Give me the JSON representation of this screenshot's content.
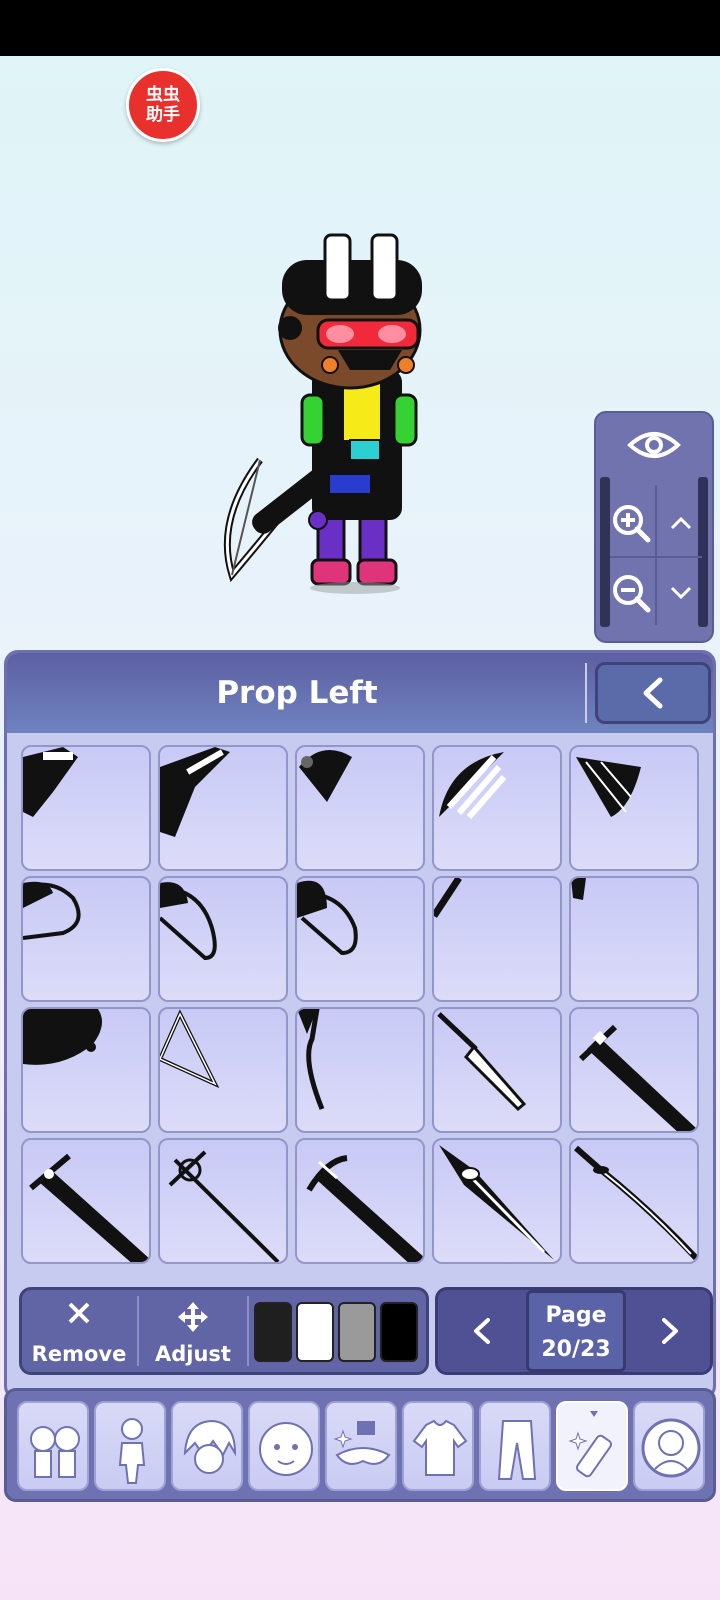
{
  "helper_badge": {
    "line1": "虫虫",
    "line2": "助手"
  },
  "panel": {
    "title": "Prop Left"
  },
  "tools": {
    "remove_label": "Remove",
    "adjust_label": "Adjust"
  },
  "swatches": [
    "#1f1f1f",
    "#ffffff",
    "#9a9a9a",
    "#000000"
  ],
  "pager": {
    "page_label": "Page",
    "page_value": "20/23"
  },
  "props": [
    "gun-partial",
    "gun-partial-2",
    "fan-small-black",
    "fan-striped",
    "fan-black",
    "bow-partial",
    "bow-partial-2",
    "bow-partial-3",
    "stick-partial",
    "blank-dot",
    "blob-partial",
    "triangle-frame",
    "hook-partial",
    "machete",
    "greatsword",
    "greatsword-2",
    "rapier",
    "curved-greatsword",
    "ornate-blade",
    "katana"
  ],
  "tabs": [
    "characters",
    "body",
    "hair",
    "face",
    "accessories",
    "top",
    "bottom",
    "props",
    "profile"
  ],
  "active_tab": "props"
}
